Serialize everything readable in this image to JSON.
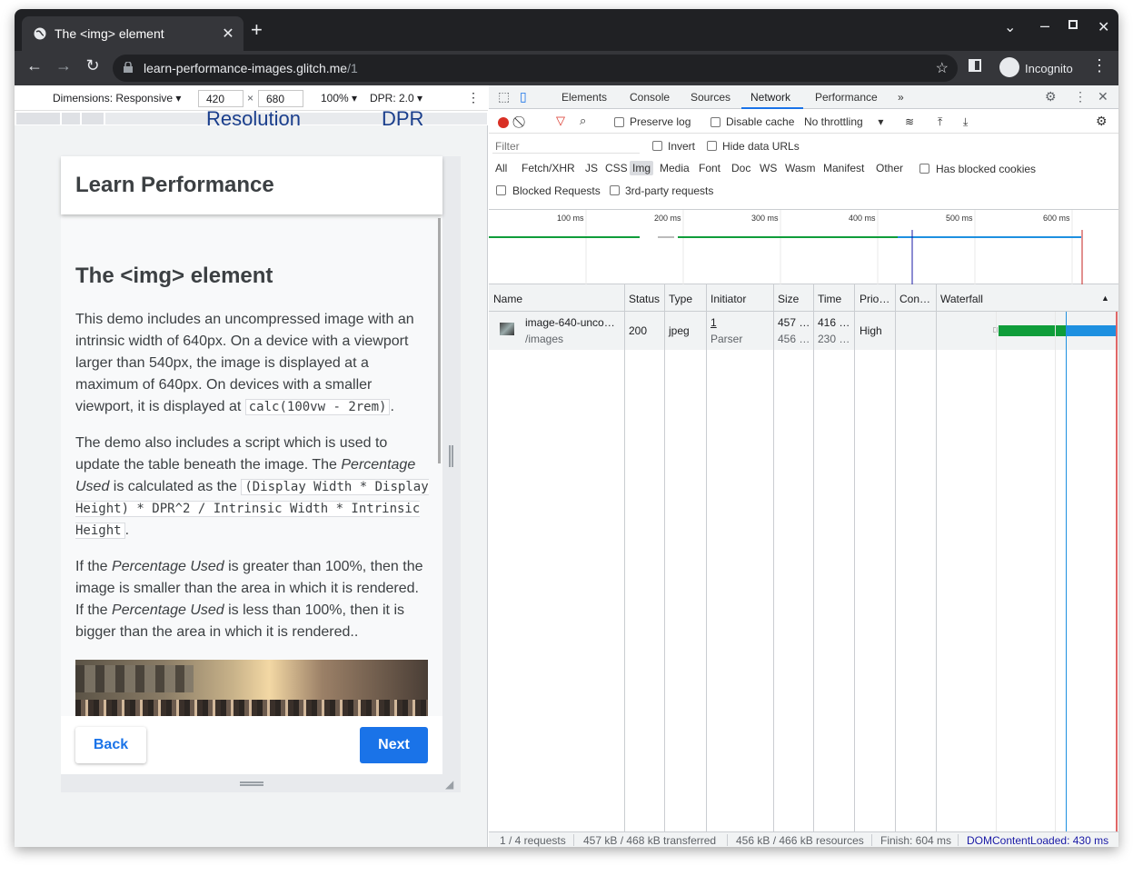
{
  "browser": {
    "tab_title": "The <img> element",
    "url_host": "learn-performance-images.glitch.me",
    "url_path": "/1",
    "profile_label": "Incognito"
  },
  "device_toolbar": {
    "dimensions_label": "Dimensions: Responsive",
    "width": "420",
    "height": "680",
    "times": "×",
    "zoom": "100%",
    "dpr": "DPR: 2.0",
    "annotation_resolution": "Resolution",
    "annotation_dpr": "DPR"
  },
  "page": {
    "header_title": "Learn Performance",
    "heading": "The <img> element",
    "p1_text": "This demo includes an uncompressed image with an intrinsic width of 640px. On a device with a viewport larger than 540px, the image is displayed at a maximum of 640px. On devices with a smaller viewport, it is displayed at ",
    "p1_code": "calc(100vw - 2rem)",
    "p1_end": ".",
    "p2_a": "The demo also includes a script which is used to update the table beneath the image. The ",
    "p2_em1": "Percentage Used",
    "p2_b": " is calculated as the ",
    "p2_code": "(Display Width * Display Height) * DPR^2 / Intrinsic Width * Intrinsic Height",
    "p2_end": ".",
    "p3_a": "If the ",
    "p3_em1": "Percentage Used",
    "p3_b": " is greater than 100%, then the image is smaller than the area in which it is rendered. If the ",
    "p3_em2": "Percentage Used",
    "p3_c": " is less than 100%, then it is bigger than the area in which it is rendered..",
    "back_label": "Back",
    "next_label": "Next"
  },
  "devtools": {
    "tabs": [
      "Elements",
      "Console",
      "Sources",
      "Network",
      "Performance"
    ],
    "active_tab": "Network",
    "more_tabs": "»",
    "toolbar": {
      "preserve_log": "Preserve log",
      "disable_cache": "Disable cache",
      "throttling": "No throttling"
    },
    "filter": {
      "placeholder": "Filter",
      "invert": "Invert",
      "hide_data_urls": "Hide data URLs",
      "types": [
        "All",
        "Fetch/XHR",
        "JS",
        "CSS",
        "Img",
        "Media",
        "Font",
        "Doc",
        "WS",
        "Wasm",
        "Manifest",
        "Other"
      ],
      "selected_type": "Img",
      "has_blocked_cookies": "Has blocked cookies",
      "blocked_requests": "Blocked Requests",
      "third_party": "3rd-party requests"
    },
    "overview_ticks": [
      "100 ms",
      "200 ms",
      "300 ms",
      "400 ms",
      "500 ms",
      "600 ms"
    ],
    "columns": [
      "Name",
      "Status",
      "Type",
      "Initiator",
      "Size",
      "Time",
      "Prio…",
      "Con…",
      "Waterfall"
    ],
    "rows": [
      {
        "name": "image-640-unco…",
        "path": "/images",
        "status": "200",
        "type": "jpeg",
        "initiator": "1",
        "initiator_sub": "Parser",
        "size": "457 …",
        "size_sub": "456 …",
        "time": "416 …",
        "time_sub": "230 …",
        "priority": "High"
      }
    ],
    "status": {
      "requests": "1 / 4 requests",
      "transferred": "457 kB / 468 kB transferred",
      "resources": "456 kB / 466 kB resources",
      "finish": "Finish: 604 ms",
      "dcl": "DOMContentLoaded: 430 ms"
    }
  },
  "colors": {
    "accent": "#1a73e8",
    "record": "#d93025",
    "dcl_blue": "#1a1aa6",
    "waterfall_green": "#0f9d3a",
    "waterfall_blue": "#1e90e0"
  }
}
